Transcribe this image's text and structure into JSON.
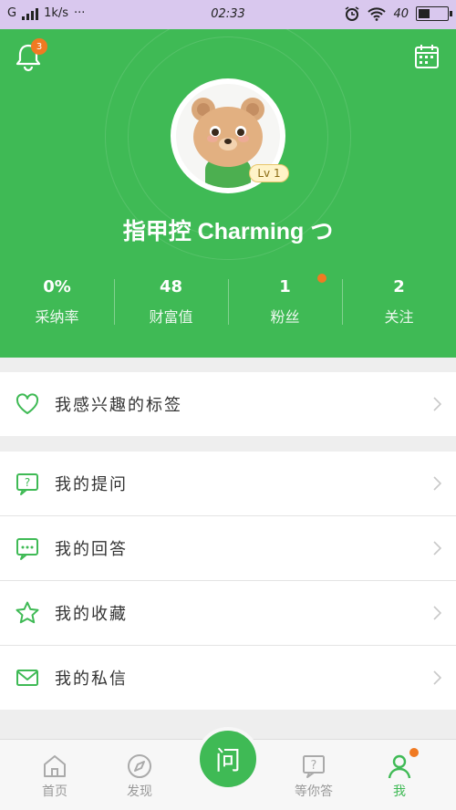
{
  "status_bar": {
    "carrier": "G",
    "speed": "1k/s",
    "dots": "···",
    "time": "02:33",
    "battery_text": "40",
    "battery_level": 0.4
  },
  "header": {
    "notification_count": "3",
    "username": "指甲控 Charming つ",
    "level": "Lv 1",
    "accent_color": "#3fba55",
    "badge_color": "#f07a22",
    "icons": [
      "bell-icon",
      "calendar-icon"
    ]
  },
  "stats": [
    {
      "value": "0%",
      "label": "采纳率",
      "has_dot": false
    },
    {
      "value": "48",
      "label": "财富值",
      "has_dot": false
    },
    {
      "value": "1",
      "label": "粉丝",
      "has_dot": true
    },
    {
      "value": "2",
      "label": "关注",
      "has_dot": false
    }
  ],
  "menu": {
    "interests": {
      "label": "我感兴趣的标签",
      "icon": "heart-icon"
    },
    "questions": {
      "label": "我的提问",
      "icon": "question-bubble-icon"
    },
    "answers": {
      "label": "我的回答",
      "icon": "answer-bubble-icon"
    },
    "favorites": {
      "label": "我的收藏",
      "icon": "star-icon"
    },
    "messages": {
      "label": "我的私信",
      "icon": "envelope-icon"
    }
  },
  "bottom_nav": {
    "home": "首页",
    "discover": "发现",
    "ask": "问",
    "awaiting": "等你答",
    "me": "我"
  }
}
